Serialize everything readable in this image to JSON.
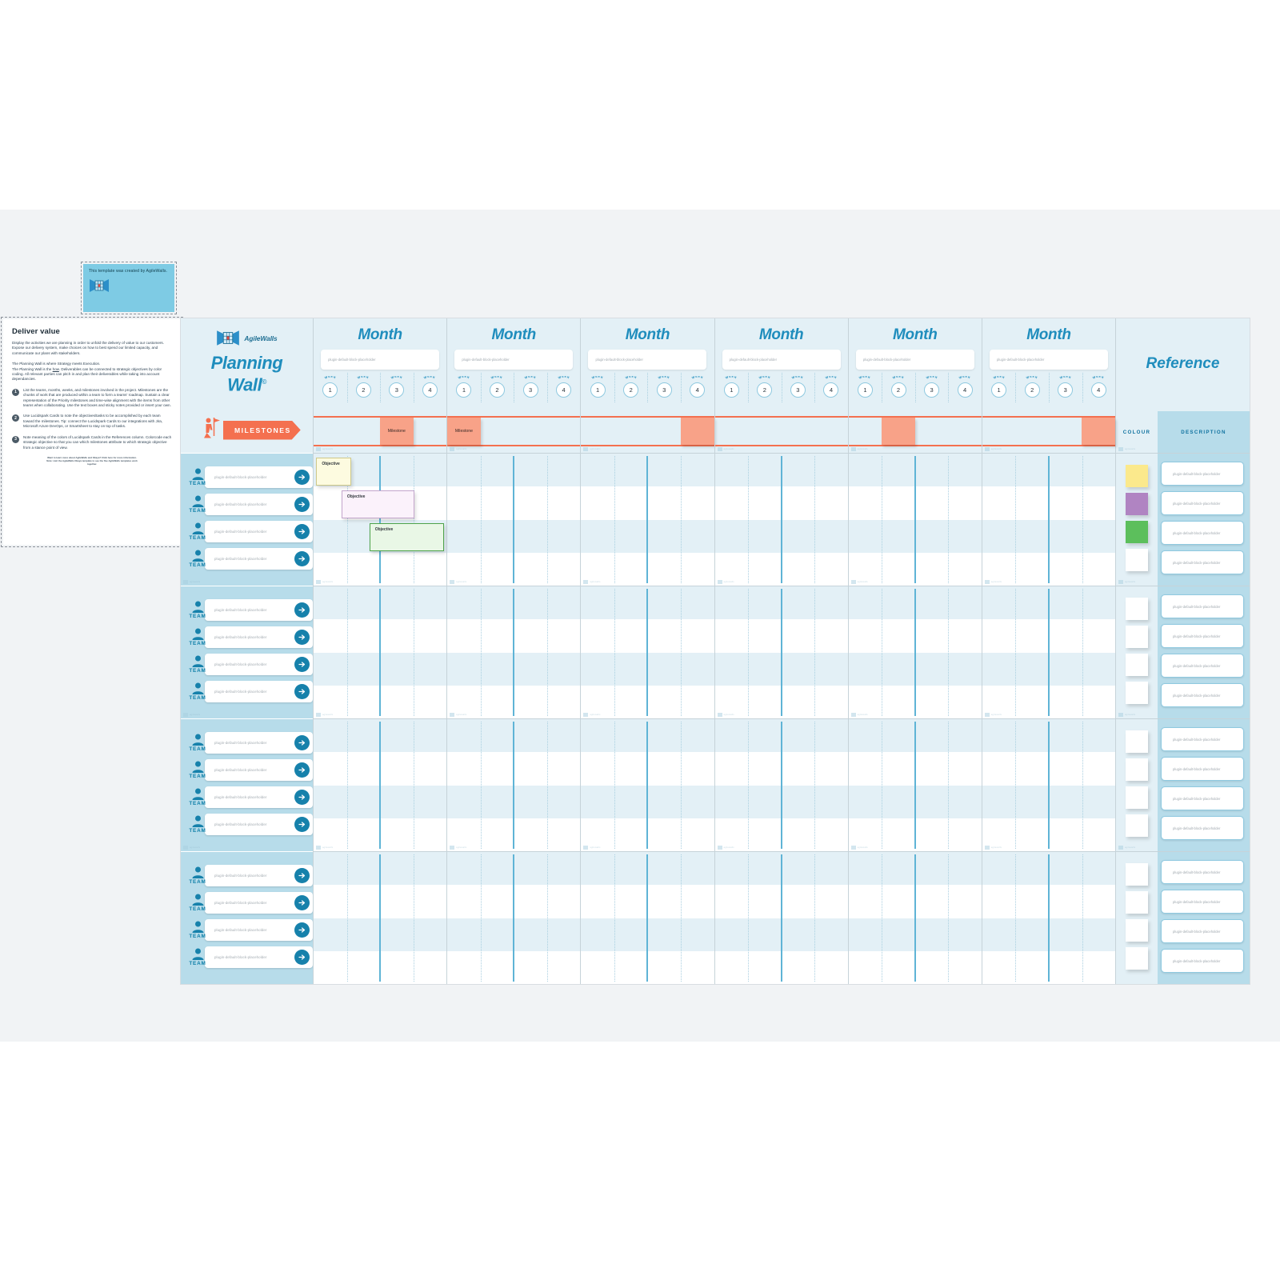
{
  "created_by_note": {
    "text": "This template was created by AgileWalls.",
    "logo_icon": "agilewalls-logo-icon"
  },
  "deliver_panel": {
    "title": "Deliver value",
    "paragraph_1": "Display the activities we are planning in order to unfold the delivery of value to our customers. Expose our delivery system, make choices on how to best spend our limited capacity, and communicate our plans with stakeholders.",
    "paragraph_2_a": "The Planning Wall is where Strategy meets Execution.",
    "paragraph_2_b": "The Planning Wall is the ",
    "paragraph_2_u": "how",
    "paragraph_2_c": ". Deliverables can be connected to strategic objectives by color coding. All relevant parties can pitch in and plan their deliverables while taking into account dependancies.",
    "steps": [
      {
        "num": "1",
        "text": "List the teams, months, weeks, and milestones involved in the project. Milestones are the chunks of work that are produced within a team to form a teams' roadmap. Sustain a clear representation of the Priority milestones and time-wise alignment with the items from other teams when collaborating. Use the text boxes and sticky notes provided or insert your own."
      },
      {
        "num": "2",
        "text": "Use Lucidspark Cards to note the objectives/tasks to be accomplished by each team toward the milestones. Tip: connect the Lucidspark Cards to our integrations with Jira, Microsoft Azure DevOps, or Smartsheet to stay on top of tasks."
      },
      {
        "num": "3",
        "text": "Note meaning of the colors of Lucidspark Cards in the References column. Colorcode each strategic objective so that you can which milestones attribute to which strategic objective from a stance point of view."
      }
    ],
    "footnote_line_1": "Want to learn more about AgileWalls and Okaya? Click here for more information.",
    "footnote_line_2": "Note: visit the AgileWalls Okaya template to see the five AgileWalls templates work",
    "footnote_line_3": "together."
  },
  "brand": {
    "logo_icon": "agilewalls-logo-icon",
    "name": "AgileWalls",
    "title_line_1": "Planning",
    "title_line_2": "Wall",
    "title_mark": "©",
    "milestones_label": "MILESTONES",
    "milestones_icon": "flag-person-icon"
  },
  "team_panel": {
    "team_label": "TEAM",
    "person_icon": "person-icon",
    "go_icon": "arrow-right-icon",
    "placeholder": "plugin-default-block-placeholder",
    "blocks": [
      {
        "rows": [
          "plugin-default-block-placeholder",
          "plugin-default-block-placeholder",
          "plugin-default-block-placeholder",
          "plugin-default-block-placeholder"
        ]
      },
      {
        "rows": [
          "plugin-default-block-placeholder",
          "plugin-default-block-placeholder",
          "plugin-default-block-placeholder",
          "plugin-default-block-placeholder"
        ]
      },
      {
        "rows": [
          "plugin-default-block-placeholder",
          "plugin-default-block-placeholder",
          "plugin-default-block-placeholder",
          "plugin-default-block-placeholder"
        ]
      },
      {
        "rows": [
          "plugin-default-block-placeholder",
          "plugin-default-block-placeholder",
          "plugin-default-block-placeholder",
          "plugin-default-block-placeholder"
        ]
      }
    ]
  },
  "months": [
    {
      "title": "Month",
      "placeholder": "plugin-default-block-placeholder",
      "weeks": [
        "1",
        "2",
        "3",
        "4"
      ],
      "week_label": "WEEK",
      "milestone": {
        "label": "Milestone",
        "start_pct": 50,
        "width_pct": 25
      }
    },
    {
      "title": "Month",
      "placeholder": "plugin-default-block-placeholder",
      "weeks": [
        "1",
        "2",
        "3",
        "4"
      ],
      "week_label": "WEEK",
      "milestone": {
        "label": "Milestone",
        "start_pct": 0,
        "width_pct": 25
      }
    },
    {
      "title": "Month",
      "placeholder": "plugin-default-block-placeholder",
      "weeks": [
        "1",
        "2",
        "3",
        "4"
      ],
      "week_label": "WEEK",
      "milestone": {
        "label": "",
        "start_pct": 75,
        "width_pct": 25
      }
    },
    {
      "title": "Month",
      "placeholder": "plugin-default-block-placeholder",
      "weeks": [
        "1",
        "2",
        "3",
        "4"
      ],
      "week_label": "WEEK",
      "milestone": null
    },
    {
      "title": "Month",
      "placeholder": "plugin-default-block-placeholder",
      "weeks": [
        "1",
        "2",
        "3",
        "4"
      ],
      "week_label": "WEEK",
      "milestone": {
        "label": "",
        "start_pct": 25,
        "width_pct": 25
      }
    },
    {
      "title": "Month",
      "placeholder": "plugin-default-block-placeholder",
      "weeks": [
        "1",
        "2",
        "3",
        "4"
      ],
      "week_label": "WEEK",
      "milestone": {
        "label": "",
        "start_pct": 75,
        "width_pct": 25
      }
    }
  ],
  "objectives": [
    {
      "label": "Objective",
      "month": 0,
      "lane": 0,
      "left_pct": 2,
      "width_pct": 26,
      "fill": "#fdfbe0",
      "border": "#cfc98a"
    },
    {
      "label": "Objective",
      "month": 0,
      "lane": 1,
      "left_pct": 21,
      "width_pct": 55,
      "fill": "#fbf2fb",
      "border": "#c4a6cc"
    },
    {
      "label": "Objective",
      "month": 0,
      "lane": 2,
      "left_pct": 42,
      "width_pct": 56,
      "fill": "#e9f7e6",
      "border": "#4ea34a"
    }
  ],
  "reference": {
    "title": "Reference",
    "colour_header": "COLOUR",
    "description_header": "DESCRIPTION",
    "placeholder": "plugin-default-block-placeholder",
    "blocks": [
      {
        "swatches": [
          "#fbe98c",
          "#b084c2",
          "#5cbf5c",
          "#ffffff"
        ],
        "descriptions": [
          "plugin-default-block-placeholder",
          "plugin-default-block-placeholder",
          "plugin-default-block-placeholder",
          "plugin-default-block-placeholder"
        ]
      },
      {
        "swatches": [
          "#ffffff",
          "#ffffff",
          "#ffffff",
          "#ffffff"
        ],
        "descriptions": [
          "plugin-default-block-placeholder",
          "plugin-default-block-placeholder",
          "plugin-default-block-placeholder",
          "plugin-default-block-placeholder"
        ]
      },
      {
        "swatches": [
          "#ffffff",
          "#ffffff",
          "#ffffff",
          "#ffffff"
        ],
        "descriptions": [
          "plugin-default-block-placeholder",
          "plugin-default-block-placeholder",
          "plugin-default-block-placeholder",
          "plugin-default-block-placeholder"
        ]
      },
      {
        "swatches": [
          "#ffffff",
          "#ffffff",
          "#ffffff",
          "#ffffff"
        ],
        "descriptions": [
          "plugin-default-block-placeholder",
          "plugin-default-block-placeholder",
          "plugin-default-block-placeholder",
          "plugin-default-block-placeholder"
        ]
      }
    ]
  },
  "watermark": {
    "text": "agilewalls",
    "icon": "watermark-icon"
  },
  "colors": {
    "accent_blue": "#1f8dbd",
    "panel_blue": "#b7dcea",
    "header_blue": "#e3f0f6",
    "milestone_orange": "#f4704f",
    "milestone_chip": "#f8a288",
    "grid_line": "#c6d3d9",
    "week_line": "#a9cfe0",
    "highlight_line": "#5fb4d6",
    "canvas": "#f1f3f5"
  }
}
